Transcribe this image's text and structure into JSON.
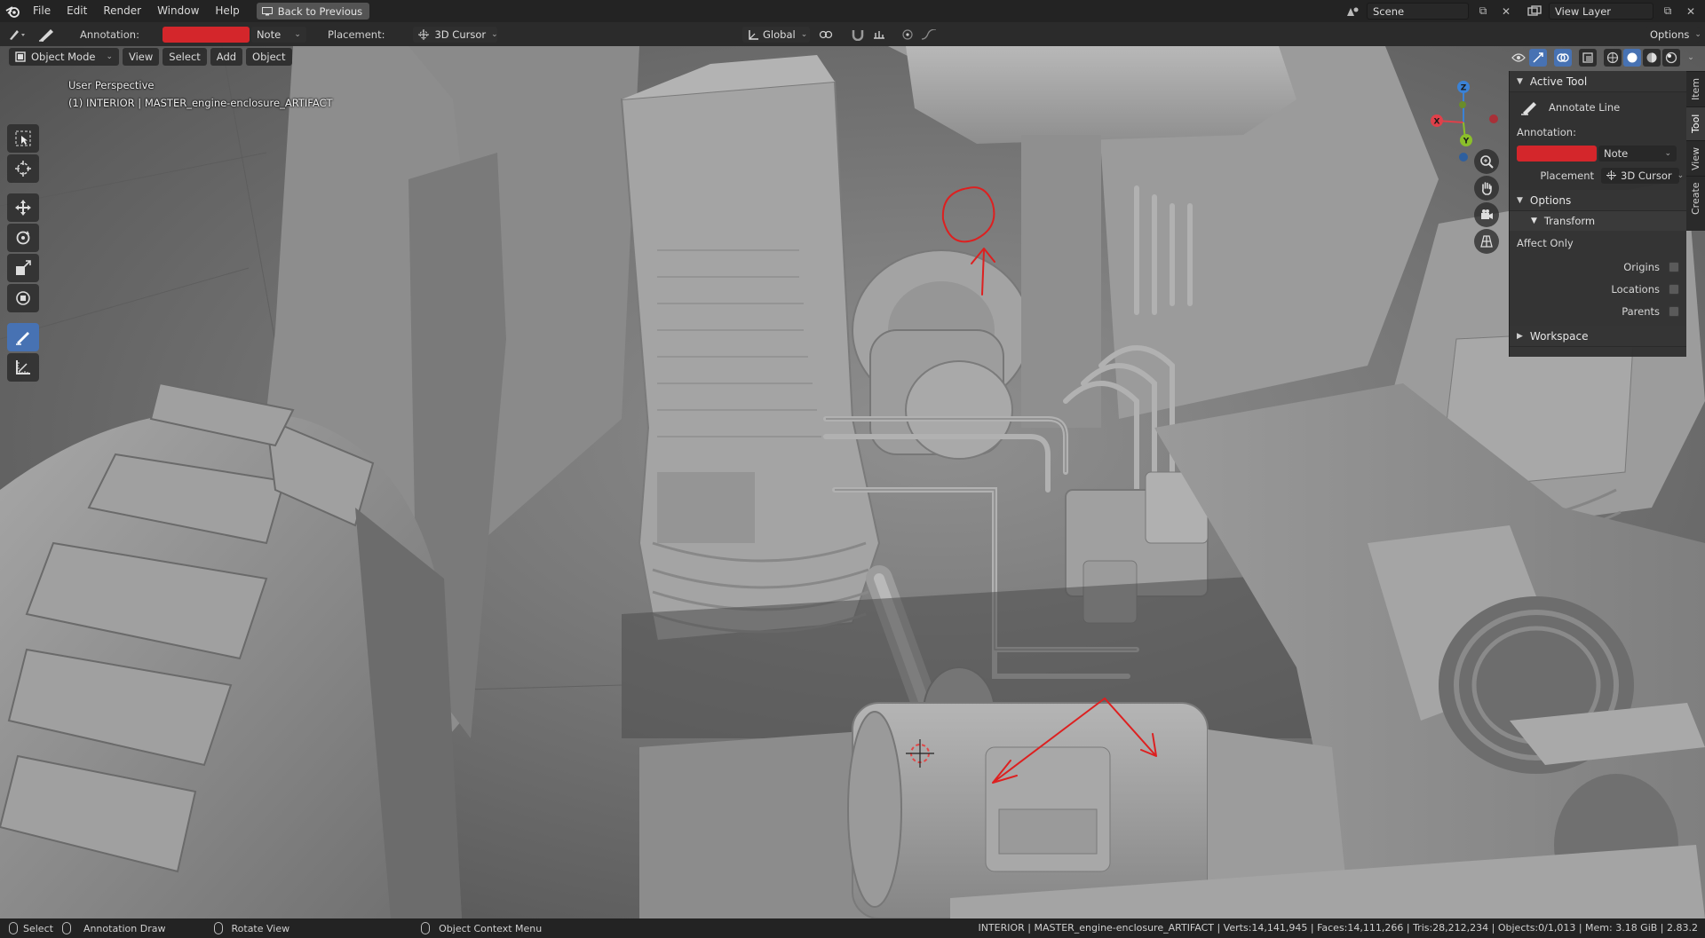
{
  "menu": {
    "items": [
      "File",
      "Edit",
      "Render",
      "Window",
      "Help"
    ],
    "back_button": "Back to Previous"
  },
  "top_right": {
    "scene": "Scene",
    "view_layer": "View Layer"
  },
  "tool_header": {
    "annotation_label": "Annotation:",
    "annotation_color": "#d4262b",
    "annotation_layer": "Note",
    "placement_label": "Placement:",
    "placement_value": "3D Cursor",
    "transform_orientation": "Global",
    "options": "Options"
  },
  "viewport_header": {
    "mode": "Object Mode",
    "menus": [
      "View",
      "Select",
      "Add",
      "Object"
    ]
  },
  "viewport_info": {
    "perspective": "User Perspective",
    "object": "(1) INTERIOR | MASTER_engine-enclosure_ARTIFACT"
  },
  "toolbar": {
    "tools": [
      "select-box-icon",
      "cursor-icon",
      "move-icon",
      "rotate-icon",
      "scale-icon",
      "transform-icon",
      "annotate-icon",
      "measure-icon"
    ],
    "active": "annotate-icon"
  },
  "gizmo": {
    "axes": [
      "X",
      "Y",
      "Z"
    ],
    "colors": {
      "x": "#e0404a",
      "y": "#8bbf2a",
      "z": "#3b82d6"
    }
  },
  "npanel": {
    "active_tool_header": "Active Tool",
    "tool_name": "Annotate Line",
    "annotation_label": "Annotation:",
    "annotation_layer": "Note",
    "placement_label": "Placement",
    "placement_value": "3D Cursor",
    "options_header": "Options",
    "transform_header": "Transform",
    "affect_only": "Affect Only",
    "checkboxes": [
      "Origins",
      "Locations",
      "Parents"
    ],
    "workspace_header": "Workspace"
  },
  "side_tabs": [
    "Item",
    "Tool",
    "View",
    "Create"
  ],
  "side_tab_active": "Tool",
  "statusbar": {
    "select": "Select",
    "annotation_draw": "Annotation Draw",
    "rotate_view": "Rotate View",
    "context_menu": "Object Context Menu",
    "stats": "INTERIOR | MASTER_engine-enclosure_ARTIFACT | Verts:14,141,945 | Faces:14,111,266 | Tris:28,212,234 | Objects:0/1,013 | Mem: 3.18 GiB | 2.83.2"
  }
}
